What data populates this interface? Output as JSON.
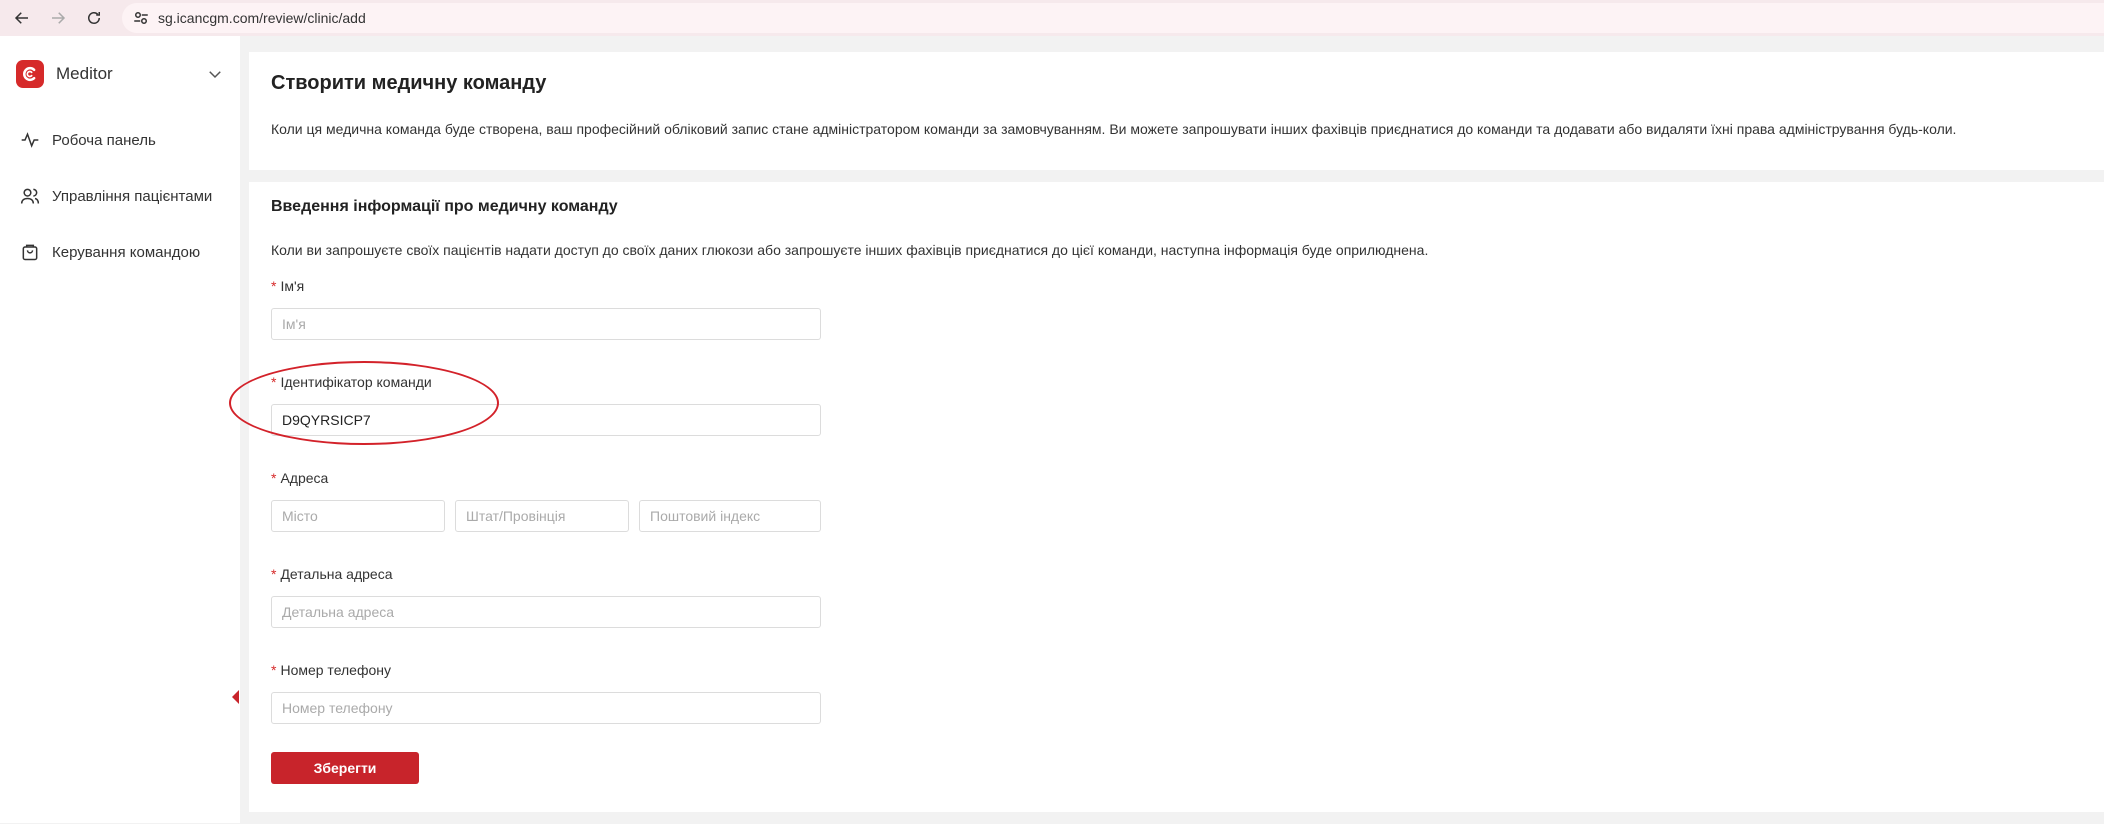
{
  "browser": {
    "url": "sg.icancgm.com/review/clinic/add"
  },
  "sidebar": {
    "brand_name": "Meditor",
    "items": [
      {
        "label": "Робоча панель",
        "icon": "activity-icon"
      },
      {
        "label": "Управління пацієнтами",
        "icon": "users-icon"
      },
      {
        "label": "Керування командою",
        "icon": "shopping-bag-icon"
      }
    ]
  },
  "header_card": {
    "title": "Створити медичну команду",
    "description": "Коли ця медична команда буде створена, ваш професійний обліковий запис стане адміністратором команди за замовчуванням. Ви можете запрошувати інших фахівців приєднатися до команди та додавати або видаляти їхні права адміністрування будь-коли."
  },
  "form": {
    "title": "Введення інформації про медичну команду",
    "description": "Коли ви запрошуєте своїх пацієнтів надати доступ до своїх даних глюкози або запрошуєте інших фахівців приєднатися до цієї команди, наступна інформація буде оприлюднена.",
    "required_mark": "*",
    "name": {
      "label": "Ім'я",
      "placeholder": "Ім'я",
      "value": ""
    },
    "team_id": {
      "label": "Ідентифікатор команди",
      "value": "D9QYRSICP7"
    },
    "address": {
      "label": "Адреса",
      "city_placeholder": "Місто",
      "state_placeholder": "Штат/Провінція",
      "zip_placeholder": "Поштовий індекс"
    },
    "detailed_address": {
      "label": "Детальна адреса",
      "placeholder": "Детальна адреса"
    },
    "phone": {
      "label": "Номер телефону",
      "placeholder": "Номер телефону"
    },
    "save_label": "Зберегти"
  },
  "colors": {
    "accent": "#c8242b",
    "required": "#d62a2a",
    "annotation": "#d3222a"
  }
}
